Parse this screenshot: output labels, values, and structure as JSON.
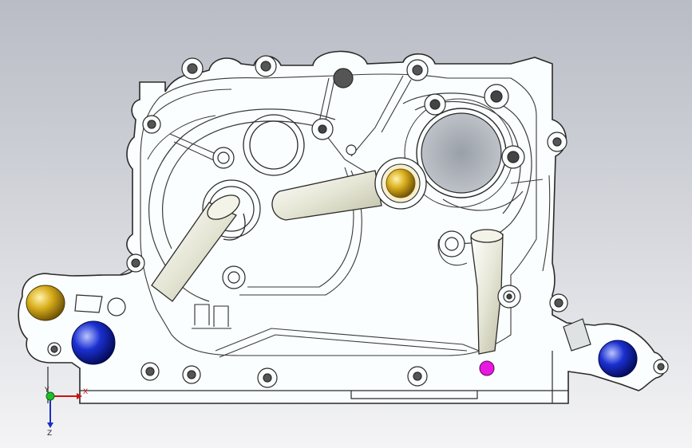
{
  "viewport": {
    "background_top": "#b9bcc5",
    "background_bottom": "#f4f4f6"
  },
  "model": {
    "part_fill": "#fbfefe",
    "edge_color": "#2a2a2a",
    "highlight_colors": {
      "gold": "#c9a012",
      "blue": "#1a2ec4",
      "magenta": "#e818e0"
    }
  },
  "triad": {
    "x_label": "X",
    "y_label": "Y",
    "z_label": "Z"
  }
}
